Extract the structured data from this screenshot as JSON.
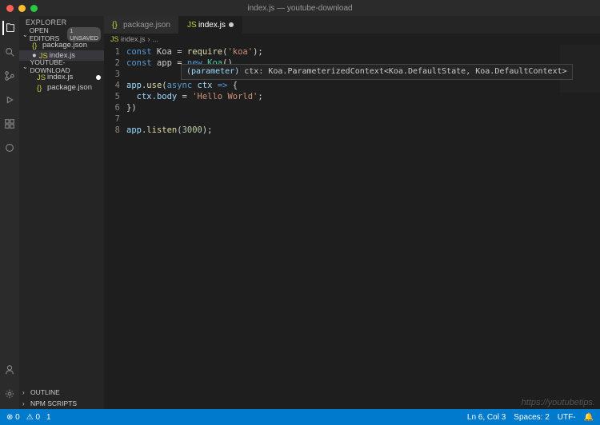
{
  "titlebar": {
    "title": "index.js — youtube-download"
  },
  "sidebar": {
    "title": "EXPLORER",
    "open_editors": {
      "label": "OPEN EDITORS",
      "badge": "1 UNSAVED"
    },
    "workspace_label": "YOUTUBE-DOWNLOAD",
    "files": {
      "open_package": "package.json",
      "open_index": "index.js",
      "ws_index": "index.js",
      "ws_package": "package.json"
    },
    "outline": "OUTLINE",
    "npm": "NPM SCRIPTS"
  },
  "tabs": {
    "package": "package.json",
    "index": "index.js"
  },
  "breadcrumbs": {
    "file": "index.js",
    "sep": "›",
    "more": "..."
  },
  "code": {
    "l1_a": "const",
    "l1_b": " Koa ",
    "l1_c": "=",
    "l1_d": " require",
    "l1_e": "(",
    "l1_f": "'koa'",
    "l1_g": ");",
    "l2_a": "const",
    "l2_b": " app ",
    "l2_c": "=",
    "l2_d": " new",
    "l2_e": " Koa",
    "l2_f": "()",
    "l4_a": "app.",
    "l4_b": "use",
    "l4_c": "(",
    "l4_d": "async",
    "l4_e": " ctx ",
    "l4_f": "=>",
    "l4_g": " {",
    "l5_a": "  ctx.",
    "l5_b": "body",
    "l5_c": " = ",
    "l5_d": "'Hello World'",
    "l5_e": ";",
    "l6_a": "})",
    "l8_a": "app.",
    "l8_b": "listen",
    "l8_c": "(",
    "l8_d": "3000",
    "l8_e": ");"
  },
  "hover": {
    "param": "(parameter)",
    "rest": " ctx: Koa.ParameterizedContext<Koa.DefaultState, Koa.DefaultContext>"
  },
  "status": {
    "errors": "0",
    "warnings": "0",
    "info": "1",
    "ln": "Ln 6, Col 3",
    "spaces": "Spaces: 2",
    "enc": "UTF-",
    "bell": "🔔"
  },
  "watermark": "https://youtubetips."
}
